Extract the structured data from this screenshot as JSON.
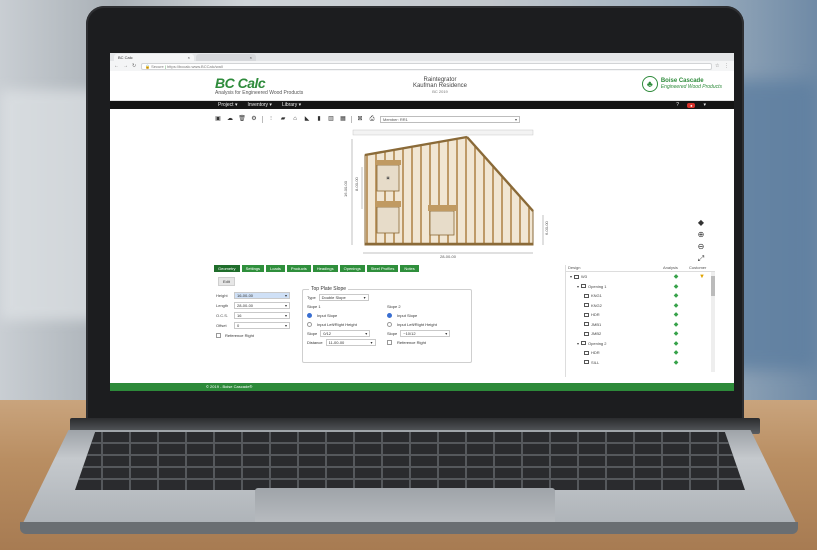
{
  "browser": {
    "tab_title": "BC Calc",
    "tab2_title": "",
    "security_label": "Secure",
    "url": "https://bccalc.www.BCCalc/wall"
  },
  "app": {
    "logo_title": "BC Calc",
    "logo_subtitle": "Analysis for Engineered Wood Products",
    "project_line1": "Raintegrator",
    "project_line2": "Kaufman Residence",
    "project_line3": "BC 2019",
    "brand_name": "Boise Cascade",
    "brand_subtitle": "Engineered Wood Products"
  },
  "menu": {
    "items": [
      "Project ▾",
      "Inventory ▾",
      "Library ▾"
    ],
    "help": "?"
  },
  "toolbar": {
    "select_label": "Member: RR1",
    "icons": [
      "save-icon",
      "cloud-icon",
      "trash-icon",
      "gear-icon",
      "beam-icon",
      "floor-icon",
      "roof-icon",
      "stair-icon",
      "column-icon",
      "wall-icon",
      "grid-icon",
      "measure-icon",
      "print-icon"
    ]
  },
  "tabs": [
    "Geometry",
    "Settings",
    "Loads",
    "Products",
    "Headings",
    "Openings",
    "Steel Profiles",
    "Notes"
  ],
  "active_tab": "Geometry",
  "edit_label": "Edit",
  "fields": [
    {
      "label": "Height",
      "value": "16-00-00"
    },
    {
      "label": "Length",
      "value": "28-00-00"
    },
    {
      "label": "O.C.S.",
      "value": "16"
    },
    {
      "label": "Offset",
      "value": "0"
    }
  ],
  "reference_right_label": "Reference Right",
  "top_plate": {
    "legend": "Top Plate Slope",
    "type_label": "Type",
    "type_value": "Double Slope",
    "slope1_label": "Slope 1",
    "slope2_label": "Slope 2",
    "input_slope": "Input Slope",
    "input_ll": "Input Left/Right Height",
    "slope_label": "Slope",
    "slope1_value": "0/12",
    "slope2_value": "~10/12",
    "distance_label": "Distance",
    "distance_value": "11-00-00",
    "reference_right": "Reference Right"
  },
  "tree": {
    "headers": [
      "Design",
      "Analysis",
      "Customer"
    ],
    "rows": [
      {
        "name": "W3",
        "depth": 0,
        "status": "ok",
        "customer": "warn"
      },
      {
        "name": "Opening 1",
        "depth": 1,
        "status": "ok",
        "customer": ""
      },
      {
        "name": "KNG1",
        "depth": 2,
        "status": "ok",
        "customer": ""
      },
      {
        "name": "KNG2",
        "depth": 2,
        "status": "ok",
        "customer": ""
      },
      {
        "name": "HDR",
        "depth": 2,
        "status": "ok",
        "customer": ""
      },
      {
        "name": "JMB1",
        "depth": 2,
        "status": "ok",
        "customer": ""
      },
      {
        "name": "JMB2",
        "depth": 2,
        "status": "ok",
        "customer": ""
      },
      {
        "name": "Opening 2",
        "depth": 1,
        "status": "ok",
        "customer": ""
      },
      {
        "name": "HDR",
        "depth": 2,
        "status": "ok",
        "customer": ""
      },
      {
        "name": "SILL",
        "depth": 2,
        "status": "ok",
        "customer": ""
      }
    ]
  },
  "canvas": {
    "dim_height": "16-00-00",
    "dim_left_mid": "8-00-00",
    "dim_right": "6-00-00",
    "dim_bottom": "28-00-00"
  },
  "footer": "© 2019 - Boise Cascade®",
  "colors": {
    "brand_green": "#2e8b3b",
    "wood": "#b2884e",
    "header_bar": "#151515"
  }
}
